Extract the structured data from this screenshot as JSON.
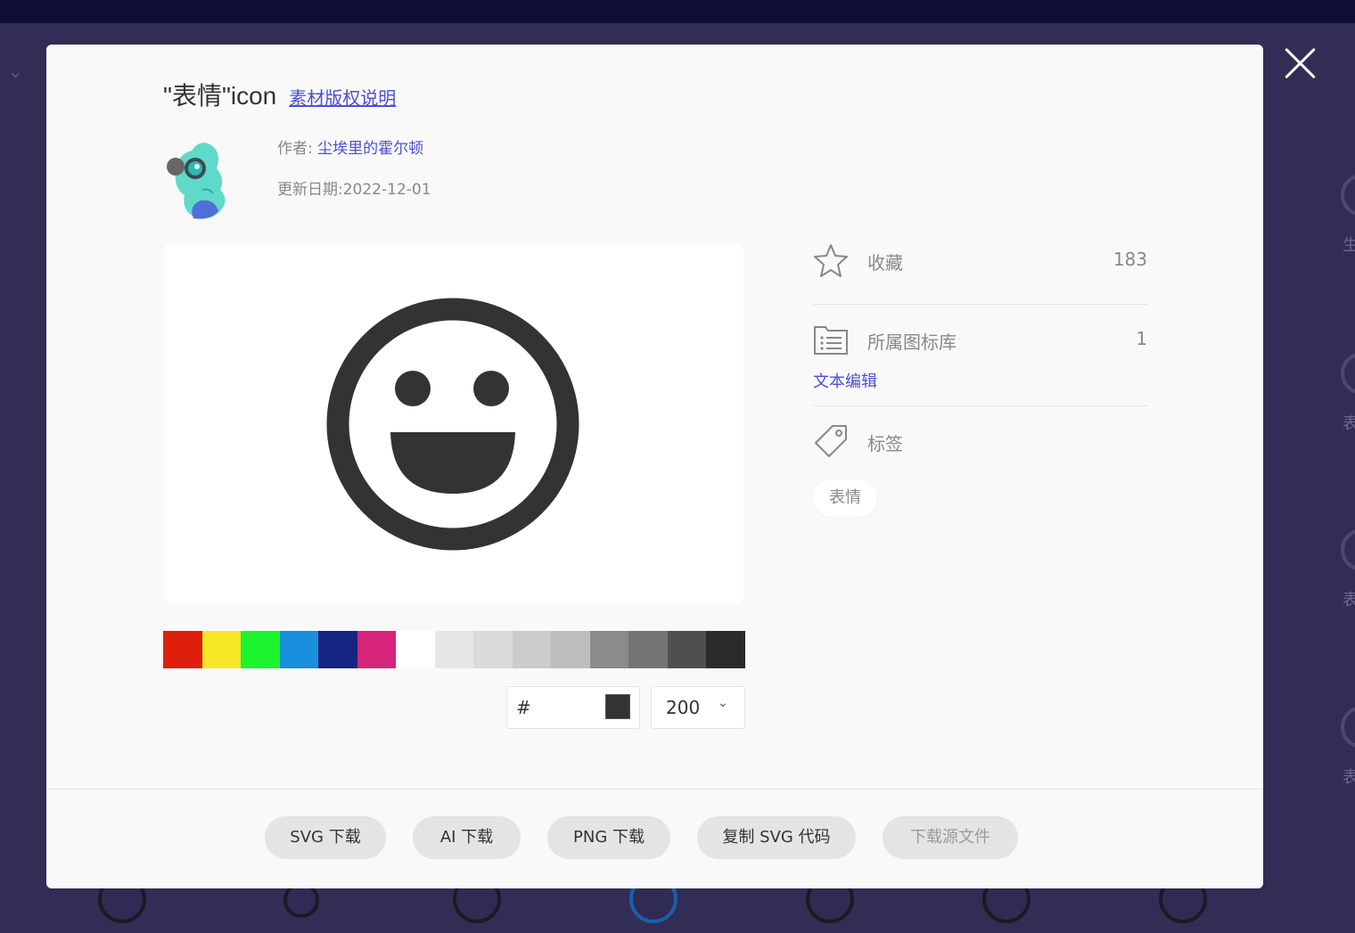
{
  "modal": {
    "title": "\"表情\"icon",
    "copyright_link": "素材版权说明",
    "author_label": "作者:",
    "author_name": "尘埃里的霍尔顿",
    "date_label": "更新日期:",
    "date_value": "2022-12-01",
    "preview_icon": "smiley-face-icon"
  },
  "colors": {
    "swatches": [
      "#dd1f0b",
      "#f6e827",
      "#1cf52e",
      "#1890dd",
      "#162581",
      "#d6247b",
      "#ffffff",
      "#e6e6e6",
      "#dadada",
      "#cbcbcb",
      "#bdbdbd",
      "#8b8b8b",
      "#747474",
      "#4f4f4f",
      "#2b2b2b"
    ],
    "current_icon_color": "#333333",
    "link_color": "#4a4fd8"
  },
  "controls": {
    "hex_prefix": "#",
    "hex_value": "",
    "size_value": "200"
  },
  "side": {
    "favorite_label": "收藏",
    "favorite_count": "183",
    "library_label": "所属图标库",
    "library_count": "1",
    "library_name": "文本编辑",
    "tags_label": "标签",
    "tags": [
      "表情"
    ]
  },
  "footer": {
    "svg_download": "SVG 下载",
    "ai_download": "AI 下载",
    "png_download": "PNG 下载",
    "copy_svg": "复制 SVG 代码",
    "source_download": "下载源文件"
  },
  "background": {
    "right_labels": [
      "生",
      "表情",
      "表",
      "表"
    ]
  }
}
